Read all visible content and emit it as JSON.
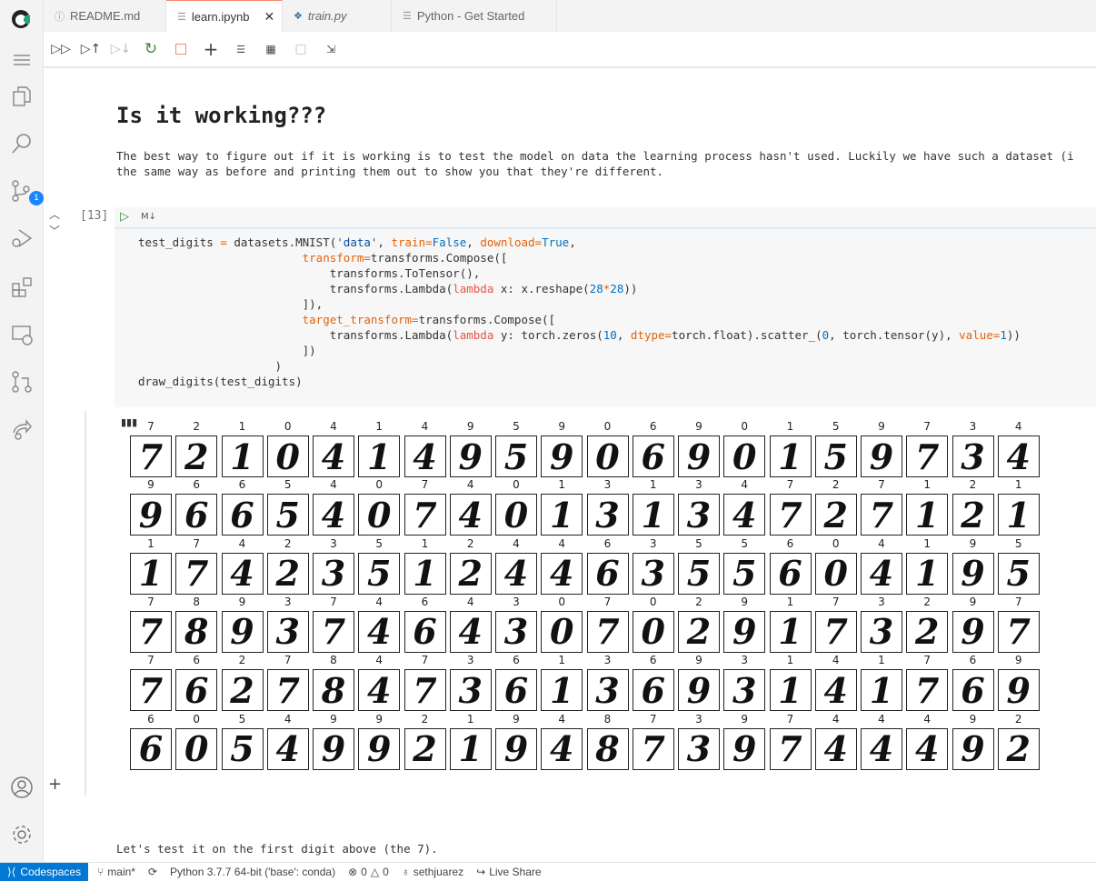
{
  "tabs": [
    {
      "label": "README.md",
      "icon": "info-icon"
    },
    {
      "label": "learn.ipynb",
      "icon": "notebook-icon",
      "active": true
    },
    {
      "label": "train.py",
      "icon": "python-icon"
    },
    {
      "label": "Python - Get Started",
      "icon": "document-icon"
    }
  ],
  "activity": {
    "scm_badge": "1"
  },
  "markdown": {
    "heading": "Is it working???",
    "paragraph": "The best way to figure out if it is working is to test the model on data the learning process hasn't used. Luckily we have such a dataset (i\nthe same way as before and printing them out to show you that they're different."
  },
  "cell": {
    "exec_count": "[13]",
    "lang_badge": "M↓",
    "code": [
      [
        [
          "test_digits ",
          ""
        ],
        [
          "=",
          "o"
        ],
        [
          " datasets.MNIST(",
          ""
        ],
        [
          "'data'",
          "s"
        ],
        [
          ", ",
          ""
        ],
        [
          "train=",
          "p"
        ],
        [
          "False",
          "n"
        ],
        [
          ", ",
          ""
        ],
        [
          "download=",
          "p"
        ],
        [
          "True",
          "n"
        ],
        [
          ",",
          ""
        ]
      ],
      [
        [
          "                        ",
          ""
        ],
        [
          "transform=",
          "p"
        ],
        [
          "transforms.Compose([",
          ""
        ]
      ],
      [
        [
          "                            transforms.ToTensor(),",
          ""
        ]
      ],
      [
        [
          "                            transforms.Lambda(",
          ""
        ],
        [
          "lambda",
          "k"
        ],
        [
          " x: x.reshape(",
          ""
        ],
        [
          "28",
          "n"
        ],
        [
          "*",
          "o"
        ],
        [
          "28",
          "n"
        ],
        [
          "))",
          ""
        ]
      ],
      [
        [
          "                        ]),",
          ""
        ]
      ],
      [
        [
          "                        ",
          ""
        ],
        [
          "target_transform=",
          "p"
        ],
        [
          "transforms.Compose([",
          ""
        ]
      ],
      [
        [
          "                            transforms.Lambda(",
          ""
        ],
        [
          "lambda",
          "k"
        ],
        [
          " y: torch.zeros(",
          ""
        ],
        [
          "10",
          "n"
        ],
        [
          ", ",
          ""
        ],
        [
          "dtype=",
          "p"
        ],
        [
          "torch.float).scatter_(",
          ""
        ],
        [
          "0",
          "n"
        ],
        [
          ", torch.tensor(y), ",
          ""
        ],
        [
          "value=",
          "p"
        ],
        [
          "1",
          "n"
        ],
        [
          "))",
          ""
        ]
      ],
      [
        [
          "                        ])",
          ""
        ]
      ],
      [
        [
          "                    )",
          ""
        ]
      ],
      [
        [
          "draw_digits(test_digits)",
          ""
        ]
      ]
    ]
  },
  "output": {
    "digit_labels": [
      [
        7,
        2,
        1,
        0,
        4,
        1,
        4,
        9,
        5,
        9,
        0,
        6,
        9,
        0,
        1,
        5,
        9,
        7,
        3,
        4
      ],
      [
        9,
        6,
        6,
        5,
        4,
        0,
        7,
        4,
        0,
        1,
        3,
        1,
        3,
        4,
        7,
        2,
        7,
        1,
        2,
        1
      ],
      [
        1,
        7,
        4,
        2,
        3,
        5,
        1,
        2,
        4,
        4,
        6,
        3,
        5,
        5,
        6,
        0,
        4,
        1,
        9,
        5
      ],
      [
        7,
        8,
        9,
        3,
        7,
        4,
        6,
        4,
        3,
        0,
        7,
        0,
        2,
        9,
        1,
        7,
        3,
        2,
        9,
        7
      ],
      [
        7,
        6,
        2,
        7,
        8,
        4,
        7,
        3,
        6,
        1,
        3,
        6,
        9,
        3,
        1,
        4,
        1,
        7,
        6,
        9
      ],
      [
        6,
        0,
        5,
        4,
        9,
        9,
        2,
        1,
        9,
        4,
        8,
        7,
        3,
        9,
        7,
        4,
        4,
        4,
        9,
        2
      ]
    ]
  },
  "next_markdown": "Let's test it on the first digit above (the 7).",
  "status": {
    "remote": "Codespaces",
    "branch": "main*",
    "python": "Python 3.7.7 64-bit ('base': conda)",
    "errors": "0",
    "warnings": "0",
    "user": "sethjuarez",
    "liveshare": "Live Share"
  },
  "colors": {
    "accent": "#0078d4",
    "tab_active_border": "#f48771",
    "run": "#388a34",
    "stop": "#f48771"
  }
}
